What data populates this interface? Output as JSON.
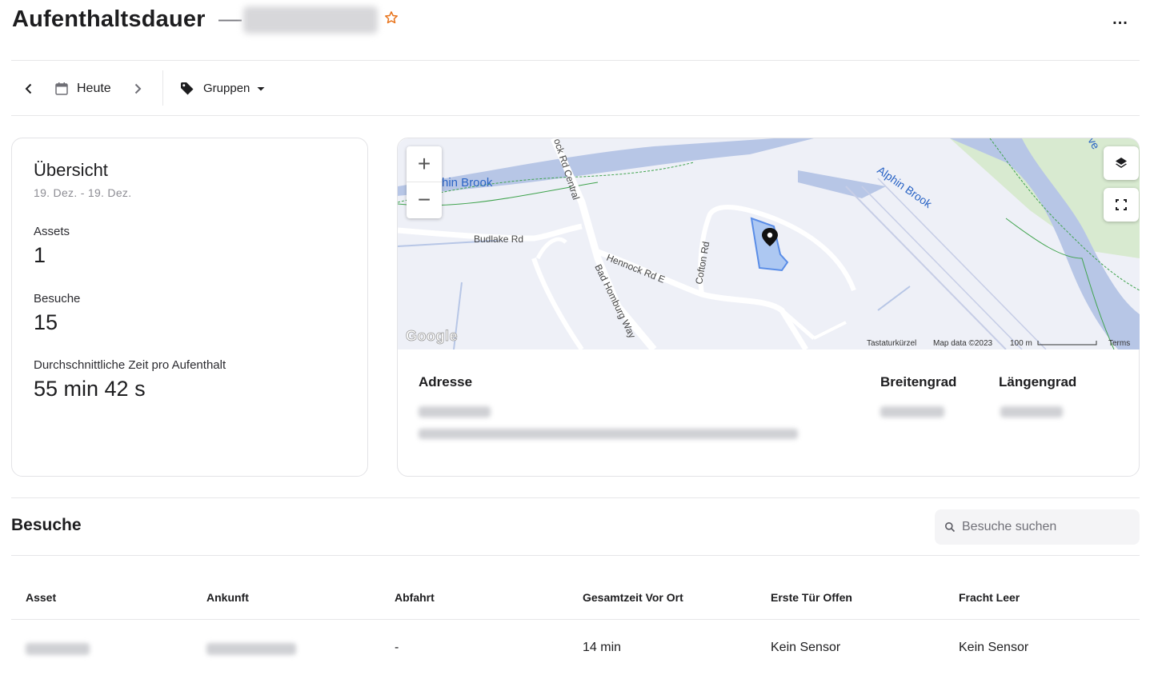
{
  "header": {
    "title": "Aufenthaltsdauer",
    "dash": "—",
    "more": "..."
  },
  "toolbar": {
    "date_label": "Heute",
    "groups_label": "Gruppen"
  },
  "overview": {
    "title": "Übersicht",
    "date_range": "19. Dez. - 19. Dez.",
    "assets_label": "Assets",
    "assets_value": "1",
    "visits_label": "Besuche",
    "visits_value": "15",
    "avg_label": "Durchschnittliche Zeit pro Aufenthalt",
    "avg_value": "55 min 42 s"
  },
  "map": {
    "labels": {
      "alphin_brook_1": "hin Brook",
      "alphin_brook_2": "Alphin Brook",
      "budlake": "Budlake Rd",
      "rock_rd": "ock Rd Central",
      "hennock": "Hennock Rd E",
      "cofton": "Cofton Rd",
      "bad_homburg": "Bad Homburg Way",
      "ave": "ve"
    },
    "footer": {
      "shortcuts": "Tastaturkürzel",
      "map_data": "Map data ©2023",
      "scale": "100 m",
      "terms": "Terms"
    },
    "logo": "Google",
    "zoom_in": "+",
    "zoom_out": "−"
  },
  "address": {
    "address_label": "Adresse",
    "lat_label": "Breitengrad",
    "lng_label": "Längengrad"
  },
  "visits": {
    "title": "Besuche",
    "search_placeholder": "Besuche suchen",
    "columns": [
      "Asset",
      "Ankunft",
      "Abfahrt",
      "Gesamtzeit Vor Ort",
      "Erste Tür Offen",
      "Fracht Leer"
    ],
    "rows": [
      {
        "asset": "",
        "arrival": "",
        "departure": "-",
        "total": "14 min",
        "door": "Kein Sensor",
        "cargo": "Kein Sensor"
      }
    ]
  },
  "colors": {
    "accent_star": "#e8731a",
    "geofence_fill": "#a7c4f2",
    "geofence_stroke": "#4a83e6",
    "map_bg": "#eef0f7",
    "water": "#b7c6e6",
    "park": "#d8ead0"
  }
}
